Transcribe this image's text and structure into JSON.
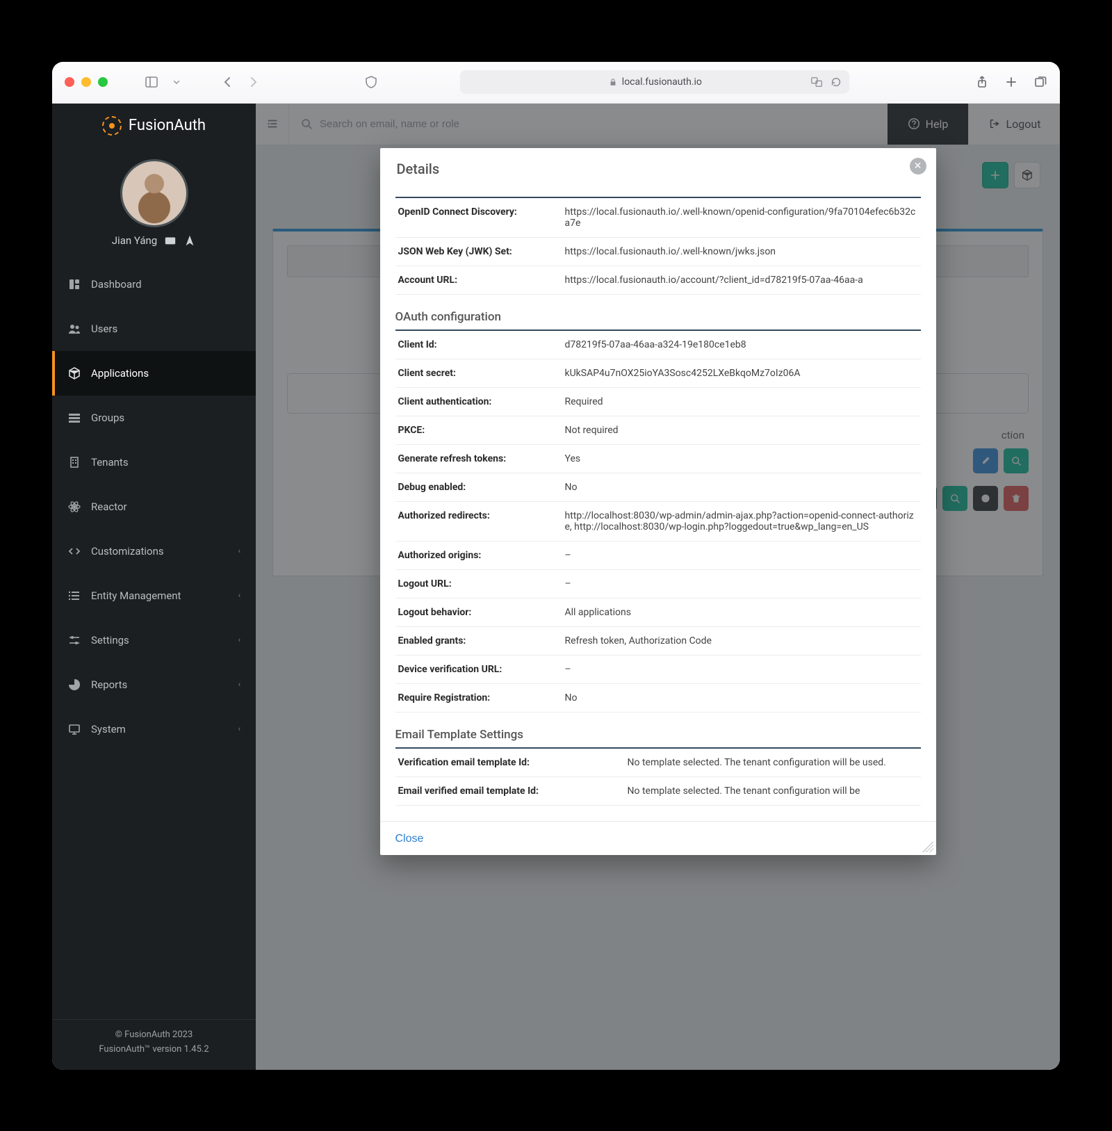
{
  "browser": {
    "url_host": "local.fusionauth.io"
  },
  "sidebar": {
    "logo": {
      "primary": "Fusion",
      "secondary": "Auth"
    },
    "user_name": "Jian Yáng",
    "footer_line1": "© FusionAuth 2023",
    "footer_line2": "FusionAuth™ version 1.45.2",
    "items": [
      {
        "label": "Dashboard",
        "icon": "dashboard"
      },
      {
        "label": "Users",
        "icon": "users"
      },
      {
        "label": "Applications",
        "icon": "cube",
        "active": true
      },
      {
        "label": "Groups",
        "icon": "groups"
      },
      {
        "label": "Tenants",
        "icon": "building"
      },
      {
        "label": "Reactor",
        "icon": "atom"
      },
      {
        "label": "Customizations",
        "icon": "code",
        "expandable": true
      },
      {
        "label": "Entity Management",
        "icon": "list",
        "expandable": true
      },
      {
        "label": "Settings",
        "icon": "sliders",
        "expandable": true
      },
      {
        "label": "Reports",
        "icon": "pie",
        "expandable": true
      },
      {
        "label": "System",
        "icon": "monitor",
        "expandable": true
      }
    ]
  },
  "topbar": {
    "search_placeholder": "Search on email, name or role",
    "help_label": "Help",
    "logout_label": "Logout"
  },
  "content": {
    "action_header": "ction"
  },
  "modal": {
    "title": "Details",
    "close_label": "Close",
    "urls_section": [
      {
        "label": "OpenID Connect Discovery:",
        "value": "https://local.fusionauth.io/.well-known/openid-configuration/9fa70104efec6b32ca7e"
      },
      {
        "label": "JSON Web Key (JWK) Set:",
        "value": "https://local.fusionauth.io/.well-known/jwks.json"
      },
      {
        "label": "Account URL:",
        "value": "https://local.fusionauth.io/account/?client_id=d78219f5-07aa-46aa-a"
      }
    ],
    "oauth_heading": "OAuth configuration",
    "oauth_section": [
      {
        "label": "Client Id:",
        "value": "d78219f5-07aa-46aa-a324-19e180ce1eb8"
      },
      {
        "label": "Client secret:",
        "value": "kUkSAP4u7nOX25ioYA3Sosc4252LXeBkqoMz7oIz06A"
      },
      {
        "label": "Client authentication:",
        "value": "Required"
      },
      {
        "label": "PKCE:",
        "value": "Not required"
      },
      {
        "label": "Generate refresh tokens:",
        "value": "Yes"
      },
      {
        "label": "Debug enabled:",
        "value": "No"
      },
      {
        "label": "Authorized redirects:",
        "value": "http://localhost:8030/wp-admin/admin-ajax.php?action=openid-connect-authorize, http://localhost:8030/wp-login.php?loggedout=true&wp_lang=en_US"
      },
      {
        "label": "Authorized origins:",
        "value": "–"
      },
      {
        "label": "Logout URL:",
        "value": "–"
      },
      {
        "label": "Logout behavior:",
        "value": "All applications"
      },
      {
        "label": "Enabled grants:",
        "value": "Refresh token, Authorization Code"
      },
      {
        "label": "Device verification URL:",
        "value": "–"
      },
      {
        "label": "Require Registration:",
        "value": "No"
      }
    ],
    "email_heading": "Email Template Settings",
    "email_section": [
      {
        "label": "Verification email template Id:",
        "value": "No template selected. The tenant configuration will be used."
      },
      {
        "label": "Email verified email template Id:",
        "value": "No template selected. The tenant configuration will be"
      }
    ]
  }
}
